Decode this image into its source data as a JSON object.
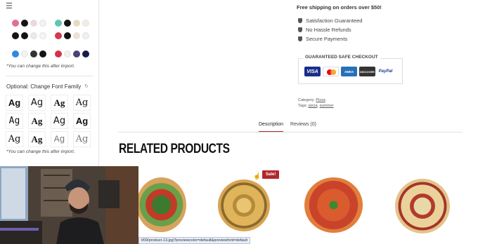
{
  "sidebar": {
    "top_icon": "menu-icon",
    "palette_rows": [
      {
        "left": [
          "#e0709a",
          "#141414",
          "#f0d7d7",
          "#f2f2f2"
        ],
        "right": [
          "#5fc4b3",
          "#141414",
          "#ead9b2",
          "#f5ede1"
        ]
      },
      {
        "left": [
          "#141414",
          "#141414",
          "#eaeaea",
          "#f5f5f5"
        ],
        "right": [
          "#d03b4c",
          "#141414",
          "#efe2d2",
          "#f4efe9"
        ]
      },
      {
        "left": [
          "#2f8be0",
          "#f2f2f2",
          "#333333",
          "#141414"
        ],
        "right": [
          "#d9304a",
          "#f0f0f0",
          "#4b4176",
          "#161b4a"
        ]
      }
    ],
    "palette_note": "*You can change this after import.",
    "font_heading": "Optional: Change Font Family",
    "font_sample": "Ag",
    "font_note": "*You can change this after import."
  },
  "product": {
    "shipping": "Free shipping on orders over $50!",
    "features": [
      "Satisfaction Guaranteed",
      "No Hassle Refunds",
      "Secure Payments"
    ],
    "checkout_title": "GUARANTEED SAFE CHECKOUT",
    "cards": [
      "VISA",
      "",
      "AMEX",
      "DISCOVER",
      "PayPal"
    ],
    "category_label": "Category:",
    "category_value": "Pizza",
    "tags_label": "Tags:",
    "tag_1": "pizza",
    "tag_2": "summer"
  },
  "tabs": [
    "Description",
    "Reviews (0)"
  ],
  "related_title": "RELATED PRODUCTS",
  "sale_badge": "Sale!",
  "status_url": "t/09/product-13.jpg?previewcolor=default&previewfont=default",
  "colors": {
    "accent": "#b3262a"
  }
}
